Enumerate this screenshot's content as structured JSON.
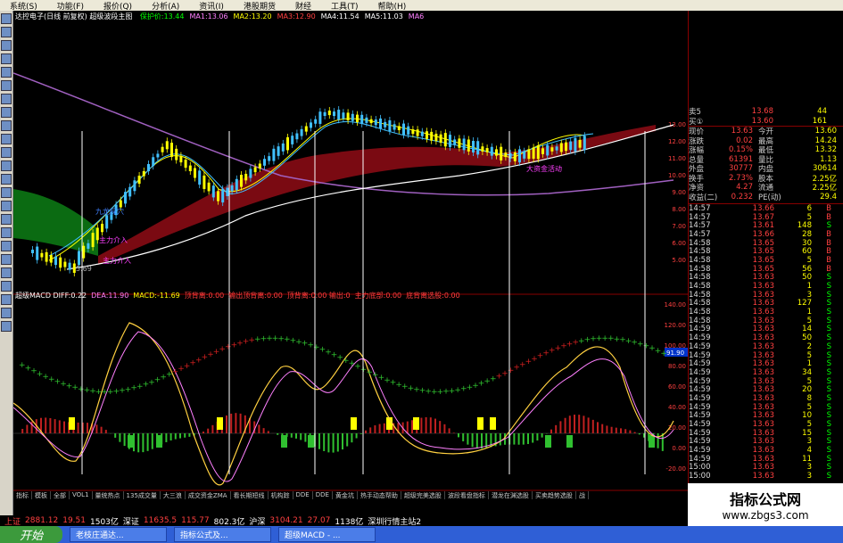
{
  "menu": [
    "系统(S)",
    "功能(F)",
    "报价(Q)",
    "分析(A)",
    "资讯(I)",
    "港股期货",
    "财经",
    "工具(T)",
    "帮助(H)"
  ],
  "main_title": {
    "text": "达控电子(日线 前复权) 超级波段主图",
    "items": [
      {
        "label": "保护价:13.44",
        "color": "#00ff00"
      },
      {
        "label": "MA1:13.06",
        "color": "#ff80ff"
      },
      {
        "label": "MA2:13.20",
        "color": "#ffff00"
      },
      {
        "label": "MA3:12.90",
        "color": "#ff4040"
      },
      {
        "label": "MA4:11.54",
        "color": "#ffffff"
      },
      {
        "label": "MA5:11.03",
        "color": "#ffffff"
      },
      {
        "label": "MA6",
        "color": "#ff80ff"
      }
    ]
  },
  "annotations": [
    "九龙探穴",
    "主力介入",
    "主力介入",
    "5.69",
    "大资金活动"
  ],
  "macd_title": {
    "items": [
      {
        "label": "超级MACD DIFF:0.22",
        "color": "#ffffff"
      },
      {
        "label": "DEA:11.90",
        "color": "#ff80ff"
      },
      {
        "label": "MACD:-11.69",
        "color": "#ffff00"
      },
      {
        "label": "顶背离:0.00",
        "color": "#ff4040"
      },
      {
        "label": "输出顶背离:0.00",
        "color": "#ff4040"
      },
      {
        "label": "顶背离:0.00 输出:0",
        "color": "#ff4040"
      },
      {
        "label": "主力底部:0.00",
        "color": "#ff4040"
      },
      {
        "label": "底背离选股:0.00",
        "color": "#ff4040"
      }
    ]
  },
  "price_axis": [
    "13.00",
    "12.00",
    "11.00",
    "10.00",
    "9.00",
    "8.00",
    "7.00",
    "6.00",
    "5.00"
  ],
  "macd_axis": [
    "140.00",
    "120.00",
    "100.00",
    "80.00",
    "60.00",
    "40.00",
    "20.00",
    "0.00",
    "-20.00"
  ],
  "macd_marker": "91.90",
  "date_axis": [
    "2009年",
    "2",
    "3",
    "4",
    "2009/04/15/三",
    "5",
    "6",
    "7",
    "8",
    "9"
  ],
  "quote": {
    "rows": [
      {
        "l1": "卖5",
        "v1": "13.68",
        "v2": "44"
      },
      {
        "l1": "买①",
        "v1": "13.60",
        "v2": "161"
      }
    ],
    "stats": [
      {
        "k1": "现价",
        "v1": "13.63",
        "k2": "今开",
        "v2": "13.60"
      },
      {
        "k1": "涨跌",
        "v1": "0.02",
        "k2": "最高",
        "v2": "14.24"
      },
      {
        "k1": "涨幅",
        "v1": "0.15%",
        "k2": "最低",
        "v2": "13.32"
      },
      {
        "k1": "总量",
        "v1": "61391",
        "k2": "量比",
        "v2": "1.13"
      },
      {
        "k1": "外盘",
        "v1": "30777",
        "k2": "内盘",
        "v2": "30614"
      },
      {
        "k1": "换手",
        "v1": "2.73%",
        "k2": "股本",
        "v2": "2.25亿"
      },
      {
        "k1": "净资",
        "v1": "4.27",
        "k2": "流通",
        "v2": "2.25亿"
      },
      {
        "k1": "收益(二)",
        "v1": "0.232",
        "k2": "PE(动)",
        "v2": "29.4"
      }
    ]
  },
  "ticks": [
    {
      "t": "14:57",
      "p": "13.66",
      "v": "6",
      "s": "B"
    },
    {
      "t": "14:57",
      "p": "13.67",
      "v": "5",
      "s": "B"
    },
    {
      "t": "14:57",
      "p": "13.61",
      "v": "148",
      "s": "S"
    },
    {
      "t": "14:57",
      "p": "13.66",
      "v": "28",
      "s": "B"
    },
    {
      "t": "14:58",
      "p": "13.65",
      "v": "30",
      "s": "B"
    },
    {
      "t": "14:58",
      "p": "13.65",
      "v": "60",
      "s": "B"
    },
    {
      "t": "14:58",
      "p": "13.65",
      "v": "5",
      "s": "B"
    },
    {
      "t": "14:58",
      "p": "13.65",
      "v": "56",
      "s": "B"
    },
    {
      "t": "14:58",
      "p": "13.63",
      "v": "50",
      "s": "S"
    },
    {
      "t": "14:58",
      "p": "13.63",
      "v": "1",
      "s": "S"
    },
    {
      "t": "14:58",
      "p": "13.63",
      "v": "3",
      "s": "S"
    },
    {
      "t": "14:58",
      "p": "13.63",
      "v": "127",
      "s": "S"
    },
    {
      "t": "14:58",
      "p": "13.63",
      "v": "1",
      "s": "S"
    },
    {
      "t": "14:58",
      "p": "13.63",
      "v": "5",
      "s": "S"
    },
    {
      "t": "14:59",
      "p": "13.63",
      "v": "14",
      "s": "S"
    },
    {
      "t": "14:59",
      "p": "13.63",
      "v": "50",
      "s": "S"
    },
    {
      "t": "14:59",
      "p": "13.63",
      "v": "2",
      "s": "S"
    },
    {
      "t": "14:59",
      "p": "13.63",
      "v": "5",
      "s": "S"
    },
    {
      "t": "14:59",
      "p": "13.63",
      "v": "1",
      "s": "S"
    },
    {
      "t": "14:59",
      "p": "13.63",
      "v": "34",
      "s": "S"
    },
    {
      "t": "14:59",
      "p": "13.63",
      "v": "5",
      "s": "S"
    },
    {
      "t": "14:59",
      "p": "13.63",
      "v": "20",
      "s": "S"
    },
    {
      "t": "14:59",
      "p": "13.63",
      "v": "8",
      "s": "S"
    },
    {
      "t": "14:59",
      "p": "13.63",
      "v": "5",
      "s": "S"
    },
    {
      "t": "14:59",
      "p": "13.63",
      "v": "10",
      "s": "S"
    },
    {
      "t": "14:59",
      "p": "13.63",
      "v": "5",
      "s": "S"
    },
    {
      "t": "14:59",
      "p": "13.63",
      "v": "15",
      "s": "S"
    },
    {
      "t": "14:59",
      "p": "13.63",
      "v": "3",
      "s": "S"
    },
    {
      "t": "14:59",
      "p": "13.63",
      "v": "4",
      "s": "S"
    },
    {
      "t": "14:59",
      "p": "13.63",
      "v": "11",
      "s": "S"
    },
    {
      "t": "15:00",
      "p": "13.63",
      "v": "3",
      "s": "S"
    },
    {
      "t": "15:00",
      "p": "13.63",
      "v": "3",
      "s": "S"
    }
  ],
  "tabs": [
    "指标",
    "模板",
    "全部",
    "VOL1",
    "量统热点",
    "135成交量",
    "大三浪",
    "成交资金ZMA",
    "看长期短线",
    "机构踪",
    "DDE",
    "DDE",
    "黄金坑",
    "热手动态帮助",
    "超级完美选股",
    "波段看盘指标",
    "潜龙在渊选股",
    "买卖趋势选股",
    "战"
  ],
  "status": [
    {
      "t": "上证",
      "c": "#ff4040"
    },
    {
      "t": "2881.12",
      "c": "#ff4040"
    },
    {
      "t": "19.51",
      "c": "#ff4040"
    },
    {
      "t": "1503亿",
      "c": "#ffffff"
    },
    {
      "t": "深证",
      "c": "#ffffff"
    },
    {
      "t": "11635.5",
      "c": "#ff4040"
    },
    {
      "t": "115.77",
      "c": "#ff4040"
    },
    {
      "t": "802.3亿",
      "c": "#ffffff"
    },
    {
      "t": "沪深",
      "c": "#ffffff"
    },
    {
      "t": "3104.21",
      "c": "#ff4040"
    },
    {
      "t": "27.07",
      "c": "#ff4040"
    },
    {
      "t": "1138亿",
      "c": "#ffffff"
    },
    {
      "t": "深圳行情主站2",
      "c": "#ffffff"
    }
  ],
  "taskbar": {
    "start": "开始",
    "tasks": [
      "老枝庄通达...",
      "指标公式及...",
      "超级MACD - ..."
    ]
  },
  "watermark": {
    "title": "指标公式网",
    "url": "www.zbgs3.com"
  }
}
